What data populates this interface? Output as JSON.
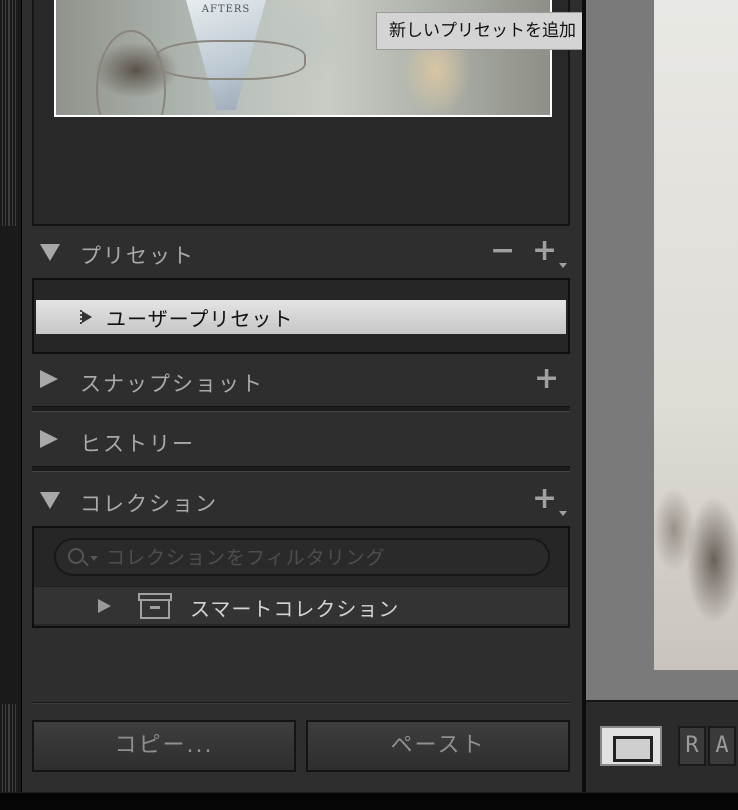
{
  "tooltip": {
    "text": "新しいプリセットを追加"
  },
  "navigator": {
    "image_text": "AFTERS"
  },
  "sections": {
    "presets": {
      "title": "プリセット",
      "remove_glyph": "−",
      "add_glyph": "+",
      "items": [
        {
          "label": "ユーザープリセット",
          "selected": true
        }
      ]
    },
    "snapshots": {
      "title": "スナップショット",
      "add_glyph": "+"
    },
    "history": {
      "title": "ヒストリー"
    },
    "collections": {
      "title": "コレクション",
      "add_glyph": "+",
      "search_placeholder": "コレクションをフィルタリング",
      "items": [
        {
          "label": "スマートコレクション"
        }
      ]
    }
  },
  "buttons": {
    "copy": "コピー...",
    "paste": "ペースト"
  },
  "toolbar": {
    "ra_letters": [
      "R",
      "A"
    ]
  },
  "colors": {
    "panel": "#2e2e2e",
    "selected_row": "#d6d6d6",
    "header_text": "#a9a9a9"
  }
}
